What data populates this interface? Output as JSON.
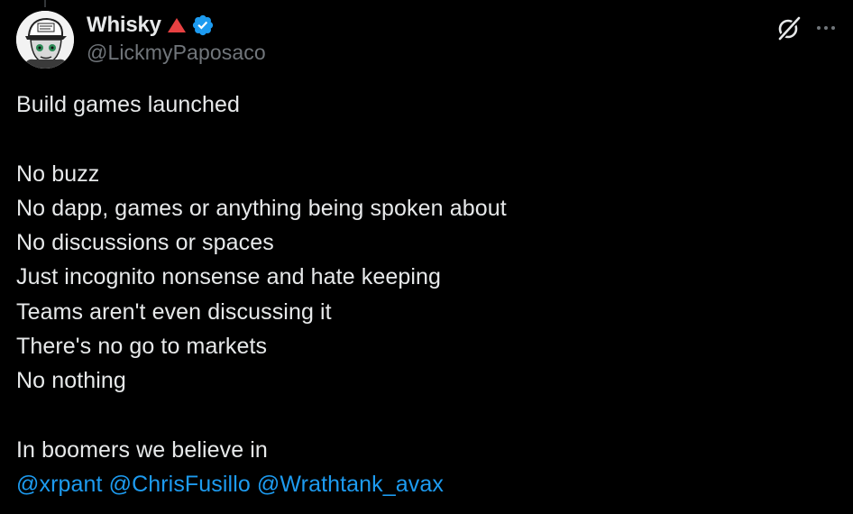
{
  "author": {
    "display_name": "Whisky",
    "handle": "@LickmyPaposaco",
    "avatar_icon": "avatar-cap-character",
    "verified_color": "#1d9bf0",
    "triangle_color": "#e84142"
  },
  "actions": {
    "grok_icon": "grok-icon",
    "more_icon": "more-icon"
  },
  "tweet": {
    "lines": [
      "Build games launched",
      "",
      "No buzz",
      "No dapp, games or anything being spoken about",
      "No discussions or spaces",
      "Just incognito nonsense and hate keeping",
      "Teams aren't even discussing it",
      "There's no go to markets",
      "No nothing",
      "",
      "In boomers we believe in"
    ],
    "mentions": [
      "@xrpant",
      "@ChrisFusillo",
      "@Wrathtank_avax"
    ]
  },
  "colors": {
    "background": "#000000",
    "text": "#e7e9ea",
    "muted": "#71767b",
    "link": "#1d9bf0"
  }
}
